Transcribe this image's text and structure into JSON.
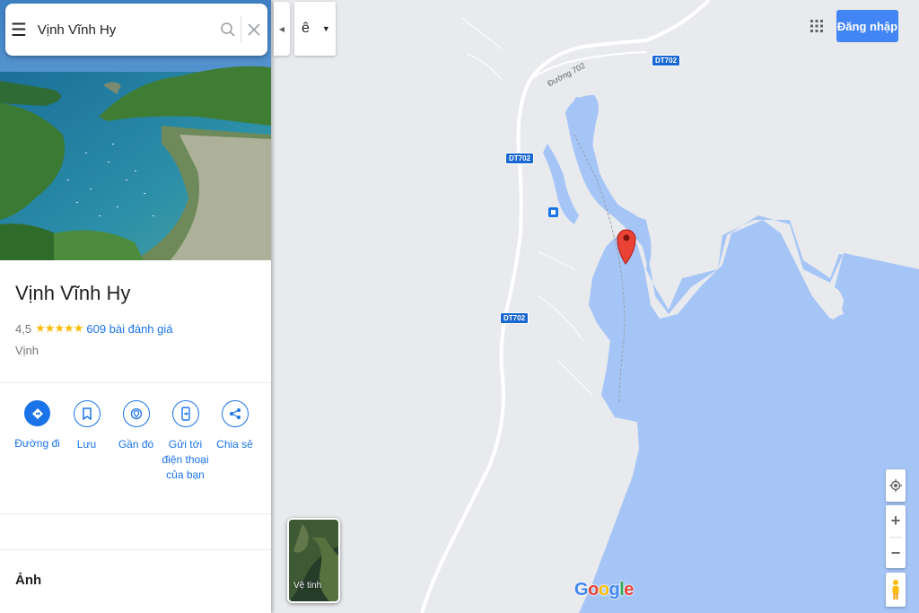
{
  "search": {
    "value": "Vịnh Vĩnh Hy"
  },
  "place": {
    "title": "Vịnh Vĩnh Hy",
    "rating": "4,5",
    "stars": "★★★★★",
    "reviews": "609 bài đánh giá",
    "type": "Vịnh"
  },
  "actions": [
    {
      "label": "Đường đi",
      "icon": "directions-icon"
    },
    {
      "label": "Lưu",
      "icon": "bookmark-icon"
    },
    {
      "label": "Gần đó",
      "icon": "nearby-icon"
    },
    {
      "label": "Gửi tới điện thoại của bạn",
      "icon": "send-to-phone-icon"
    },
    {
      "label": "Chia sẻ",
      "icon": "share-icon"
    }
  ],
  "sections": {
    "photos": "Ảnh"
  },
  "input_tool": {
    "char": "ê"
  },
  "header": {
    "signin": "Đăng nhập"
  },
  "map": {
    "road_label": "Đường 702",
    "shields": [
      "DT702",
      "DT702",
      "DT702",
      "DT702"
    ],
    "satellite_label": "Vệ tinh",
    "google_logo": [
      "G",
      "o",
      "o",
      "g",
      "l",
      "e"
    ]
  },
  "colors": {
    "water": "#a5c5f7",
    "land": "#e8eaed",
    "accent": "#1a73e8",
    "signin": "#4285f4",
    "pin": "#ea4335",
    "star": "#fbbc04"
  }
}
